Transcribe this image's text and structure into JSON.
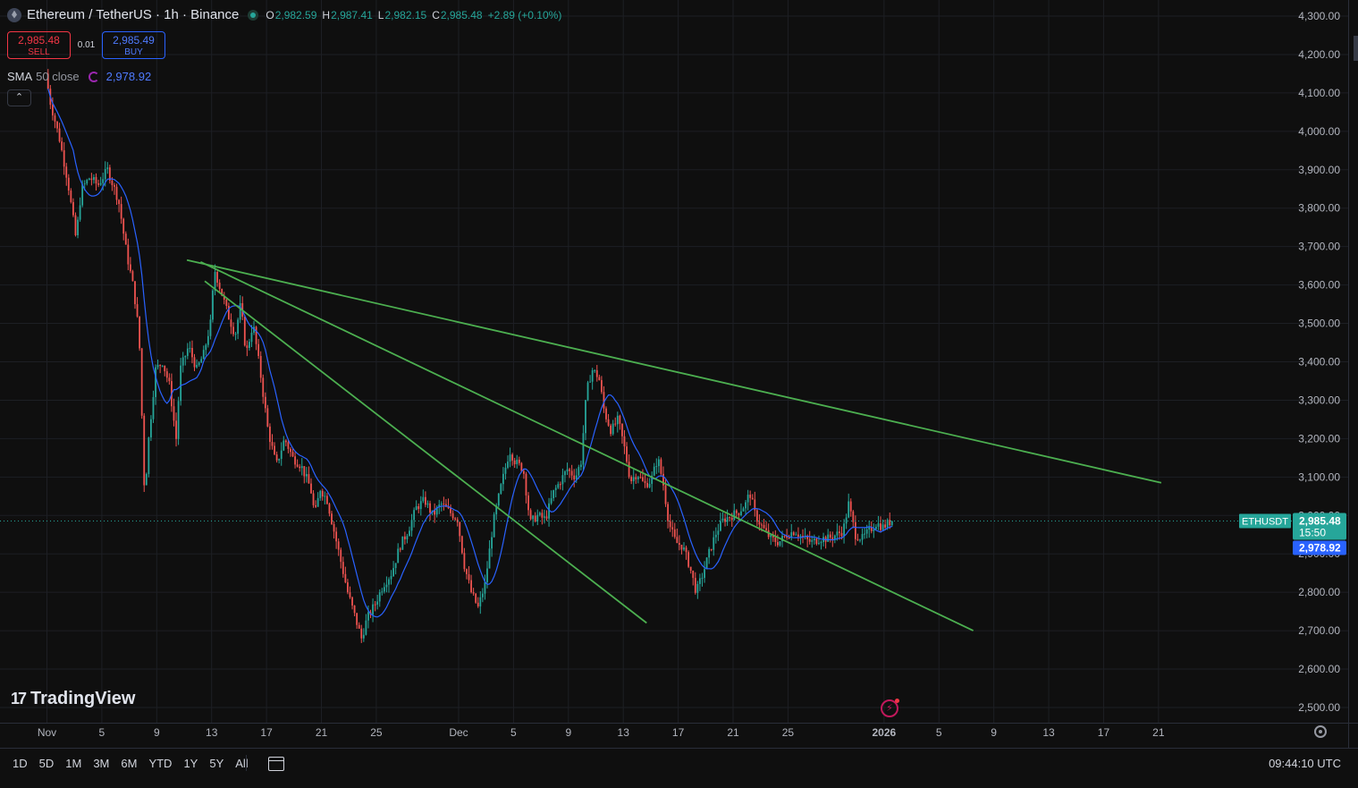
{
  "header": {
    "symbol_title": "Ethereum / TetherUS · 1h · Binance",
    "ohlc": {
      "o_key": "O",
      "o": "2,982.59",
      "h_key": "H",
      "h": "2,987.41",
      "l_key": "L",
      "l": "2,982.15",
      "c_key": "C",
      "c": "2,985.48",
      "change": "+2.89 (+0.10%)"
    }
  },
  "trade": {
    "sell_price": "2,985.48",
    "sell_label": "SELL",
    "spread": "0.01",
    "buy_price": "2,985.49",
    "buy_label": "BUY"
  },
  "indicator": {
    "name": "SMA",
    "length": "50 close",
    "value": "2,978.92"
  },
  "collapse_icon": "chevron-up-icon",
  "logo_text": "TradingView",
  "ranges": [
    "1D",
    "5D",
    "1M",
    "3M",
    "6M",
    "YTD",
    "1Y",
    "5Y",
    "All"
  ],
  "clock": "09:44:10 UTC",
  "price_labels": {
    "symbol": "ETHUSDT",
    "last_price": "2,985.48",
    "countdown": "15:50",
    "sma_value": "2,978.92"
  },
  "colors": {
    "bg": "#0f0f0f",
    "up": "#26a69a",
    "down": "#ef5350",
    "sma": "#2962ff",
    "trendline": "#4caf50",
    "text": "#d1d4dc"
  },
  "chart_data": {
    "type": "candlestick",
    "timeframe": "1h",
    "ylim": [
      2500,
      4300
    ],
    "y_ticks": [
      "4,300.00",
      "4,200.00",
      "4,100.00",
      "4,000.00",
      "3,900.00",
      "3,800.00",
      "3,700.00",
      "3,600.00",
      "3,500.00",
      "3,400.00",
      "3,300.00",
      "3,200.00",
      "3,100.00",
      "3,000.00",
      "2,900.00",
      "2,800.00",
      "2,700.00",
      "2,600.00",
      "2,500.00"
    ],
    "x_ticks": [
      "Nov",
      "5",
      "9",
      "13",
      "17",
      "21",
      "25",
      "Dec",
      "5",
      "9",
      "13",
      "17",
      "21",
      "25",
      "2026",
      "5",
      "9",
      "13",
      "17",
      "21"
    ],
    "x_tick_days": [
      0,
      4,
      8,
      12,
      16,
      20,
      24,
      30,
      34,
      38,
      42,
      46,
      50,
      54,
      61,
      65,
      69,
      73,
      77,
      81
    ],
    "last_day": 61.6,
    "price_path": [
      [
        0,
        4150
      ],
      [
        0.3,
        4080
      ],
      [
        1,
        3980
      ],
      [
        1.6,
        3870
      ],
      [
        2.2,
        3720
      ],
      [
        2.6,
        3850
      ],
      [
        3.2,
        3880
      ],
      [
        3.8,
        3860
      ],
      [
        4.5,
        3900
      ],
      [
        5.3,
        3820
      ],
      [
        5.9,
        3680
      ],
      [
        6.4,
        3590
      ],
      [
        6.8,
        3470
      ],
      [
        7.2,
        3050
      ],
      [
        7.5,
        3200
      ],
      [
        8,
        3380
      ],
      [
        8.5,
        3400
      ],
      [
        9,
        3340
      ],
      [
        9.5,
        3200
      ],
      [
        9.8,
        3380
      ],
      [
        10.4,
        3440
      ],
      [
        11,
        3380
      ],
      [
        11.5,
        3420
      ],
      [
        12,
        3500
      ],
      [
        12.3,
        3640
      ],
      [
        12.8,
        3580
      ],
      [
        13.3,
        3520
      ],
      [
        13.8,
        3470
      ],
      [
        14.2,
        3550
      ],
      [
        14.6,
        3420
      ],
      [
        15.1,
        3500
      ],
      [
        15.6,
        3380
      ],
      [
        16.2,
        3220
      ],
      [
        16.8,
        3130
      ],
      [
        17.4,
        3200
      ],
      [
        18,
        3150
      ],
      [
        18.6,
        3130
      ],
      [
        19.3,
        3070
      ],
      [
        19.6,
        3000
      ],
      [
        20,
        3070
      ],
      [
        20.5,
        3040
      ],
      [
        21,
        2960
      ],
      [
        21.5,
        2880
      ],
      [
        22,
        2800
      ],
      [
        22.5,
        2740
      ],
      [
        23,
        2680
      ],
      [
        23.4,
        2730
      ],
      [
        24,
        2770
      ],
      [
        24.6,
        2820
      ],
      [
        25.2,
        2850
      ],
      [
        25.8,
        2920
      ],
      [
        26.4,
        2960
      ],
      [
        27,
        3020
      ],
      [
        27.6,
        3040
      ],
      [
        28.2,
        3000
      ],
      [
        28.8,
        3030
      ],
      [
        29.4,
        3010
      ],
      [
        30,
        2990
      ],
      [
        30.5,
        2870
      ],
      [
        31,
        2800
      ],
      [
        31.5,
        2760
      ],
      [
        32,
        2820
      ],
      [
        32.6,
        2980
      ],
      [
        33.2,
        3080
      ],
      [
        33.8,
        3170
      ],
      [
        34.2,
        3140
      ],
      [
        34.8,
        3120
      ],
      [
        35.3,
        2980
      ],
      [
        35.8,
        3000
      ],
      [
        36.4,
        2990
      ],
      [
        37,
        3060
      ],
      [
        37.5,
        3090
      ],
      [
        38,
        3120
      ],
      [
        38.6,
        3100
      ],
      [
        39,
        3140
      ],
      [
        39.4,
        3320
      ],
      [
        39.8,
        3380
      ],
      [
        40.3,
        3360
      ],
      [
        40.7,
        3270
      ],
      [
        41.2,
        3220
      ],
      [
        41.7,
        3250
      ],
      [
        42.2,
        3170
      ],
      [
        42.6,
        3090
      ],
      [
        43.1,
        3110
      ],
      [
        43.6,
        3080
      ],
      [
        44.1,
        3090
      ],
      [
        44.6,
        3150
      ],
      [
        45,
        3080
      ],
      [
        45.4,
        2980
      ],
      [
        45.9,
        2930
      ],
      [
        46.4,
        2920
      ],
      [
        46.9,
        2870
      ],
      [
        47.4,
        2800
      ],
      [
        47.9,
        2850
      ],
      [
        48.4,
        2910
      ],
      [
        48.9,
        2960
      ],
      [
        49.4,
        2990
      ],
      [
        50,
        3000
      ],
      [
        50.5,
        3010
      ],
      [
        51,
        3030
      ],
      [
        51.3,
        3060
      ],
      [
        51.7,
        3000
      ],
      [
        52.2,
        2970
      ],
      [
        52.8,
        2940
      ],
      [
        53.4,
        2930
      ],
      [
        54,
        2950
      ],
      [
        54.6,
        2960
      ],
      [
        55.2,
        2940
      ],
      [
        55.8,
        2930
      ],
      [
        56.4,
        2940
      ],
      [
        57,
        2940
      ],
      [
        57.6,
        2950
      ],
      [
        58.1,
        2960
      ],
      [
        58.5,
        3030
      ],
      [
        59,
        2950
      ],
      [
        59.5,
        2940
      ],
      [
        60,
        2960
      ],
      [
        60.5,
        2980
      ],
      [
        61,
        2970
      ],
      [
        61.6,
        2985.48
      ]
    ],
    "trendlines": [
      {
        "from": [
          10.2,
          3665
        ],
        "to": [
          81.2,
          3085
        ]
      },
      {
        "from": [
          11.2,
          3660
        ],
        "to": [
          67.5,
          2700
        ]
      },
      {
        "from": [
          11.5,
          3610
        ],
        "to": [
          43.7,
          2720
        ]
      }
    ],
    "sma_period": 50,
    "last_price": 2985.48,
    "sma_last": 2978.92
  }
}
